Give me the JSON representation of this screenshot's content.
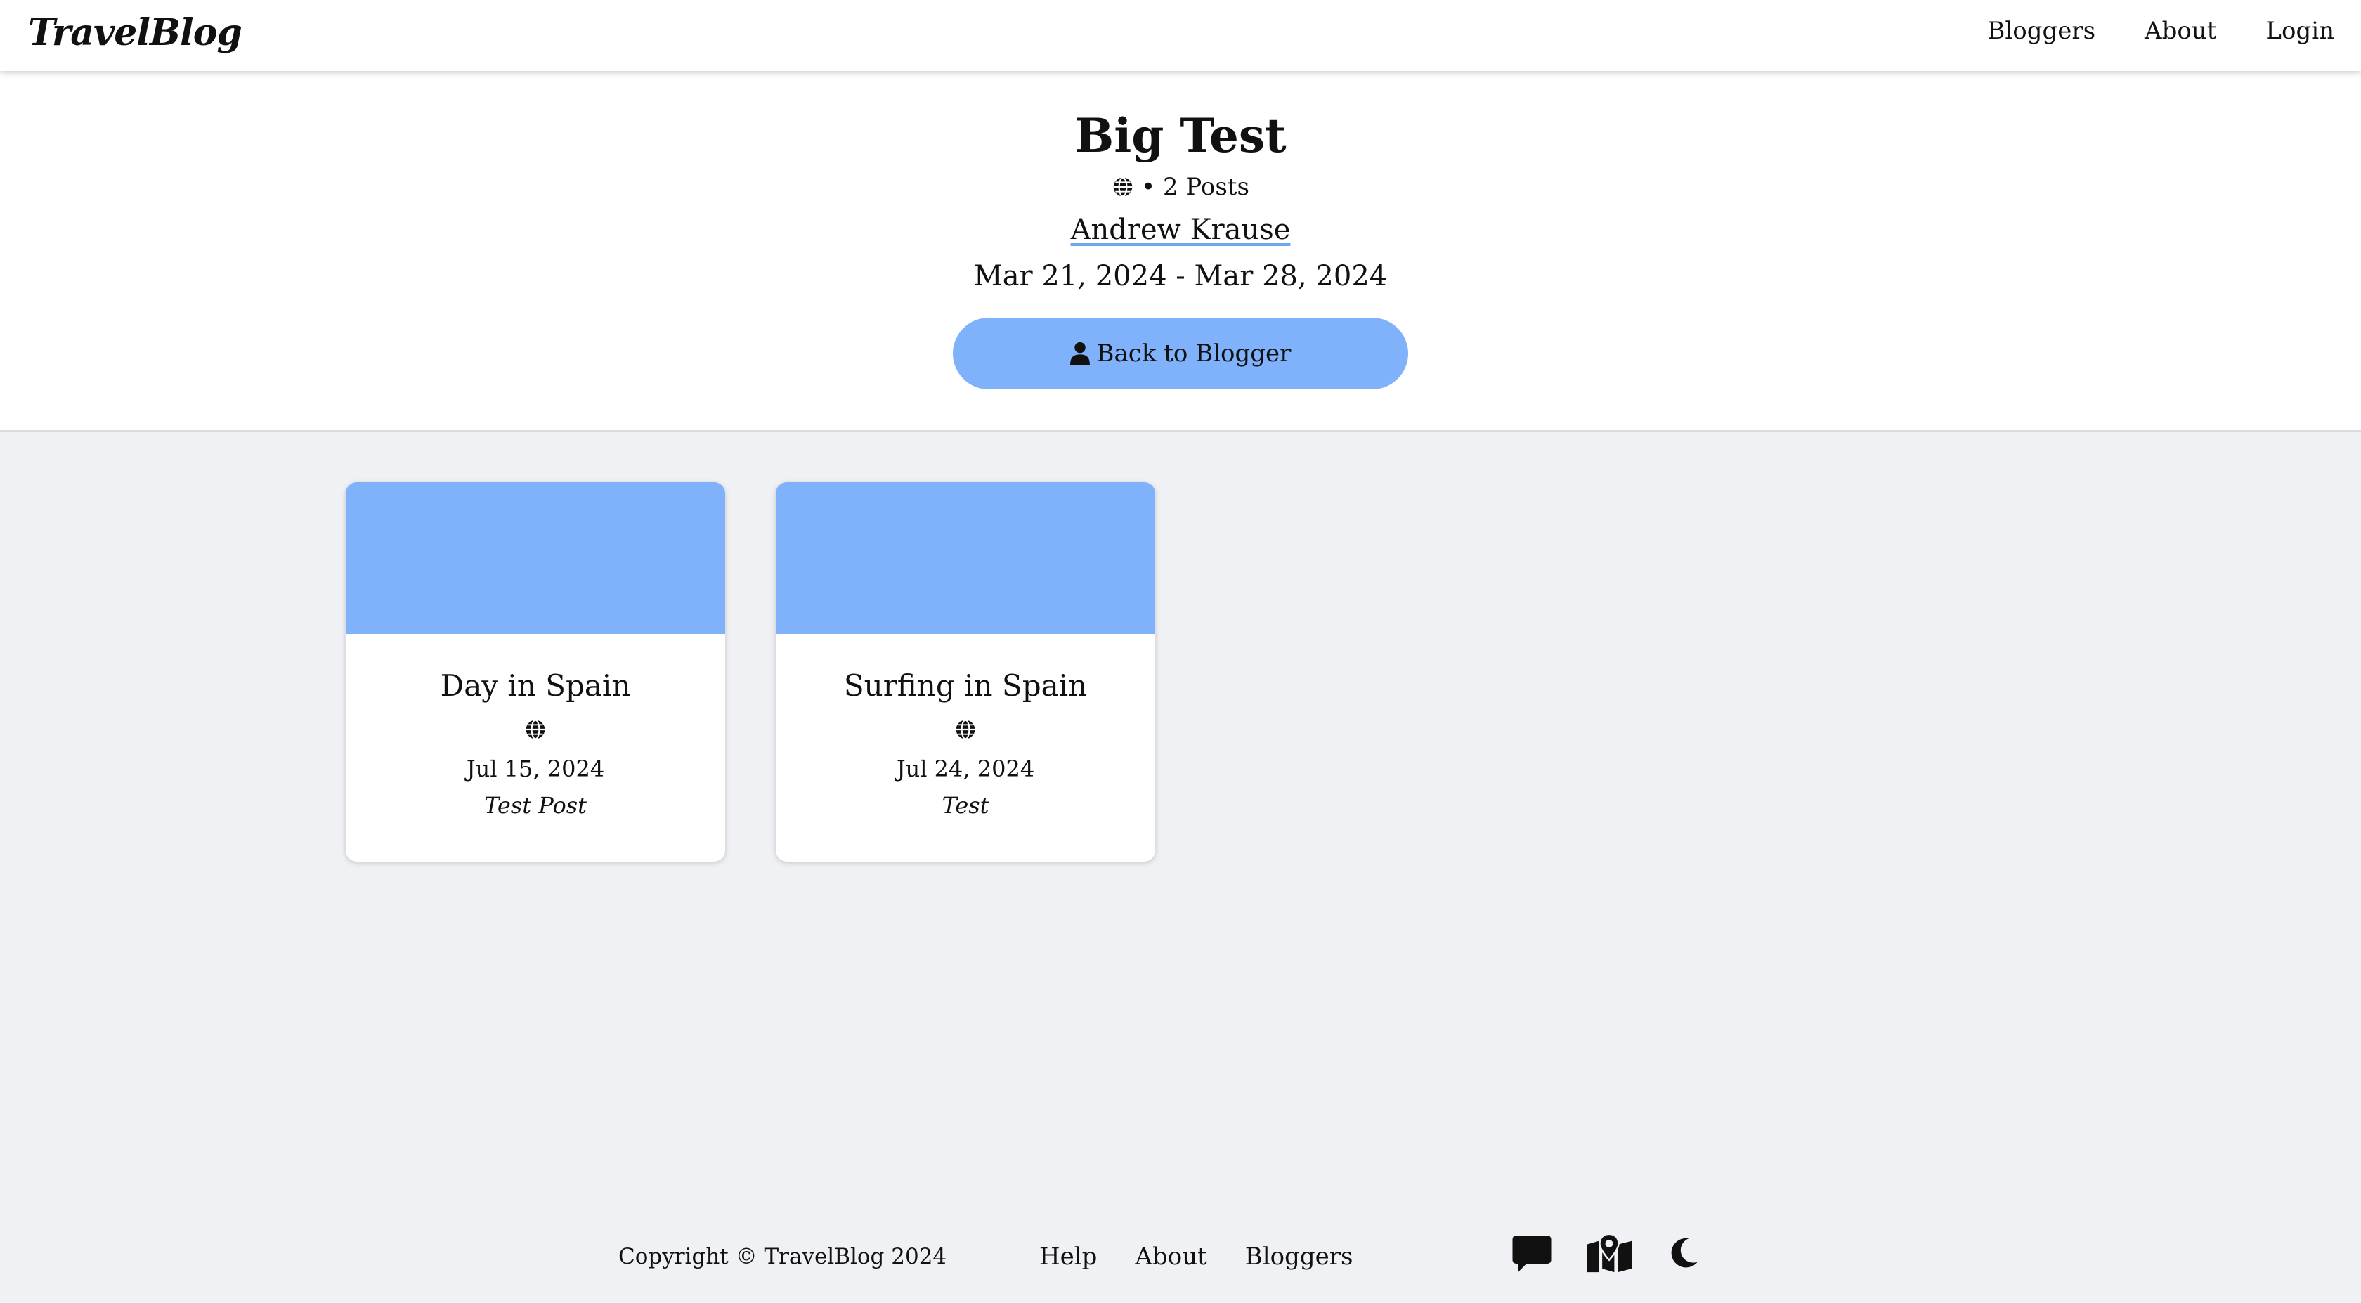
{
  "navbar": {
    "brand": "TravelBlog",
    "links": [
      "Bloggers",
      "About",
      "Login"
    ]
  },
  "trip": {
    "title": "Big Test",
    "meta": "• 2 Posts",
    "author": "Andrew Krause",
    "dates": "Mar 21, 2024 - Mar 28, 2024",
    "back_button": "Back to Blogger"
  },
  "posts": [
    {
      "title": "Day in Spain",
      "date": "Jul 15, 2024",
      "subtitle": "Test Post"
    },
    {
      "title": "Surfing in Spain",
      "date": "Jul 24, 2024",
      "subtitle": "Test"
    }
  ],
  "footer": {
    "copyright": "Copyright © TravelBlog 2024",
    "links": [
      "Help",
      "About",
      "Bloggers"
    ],
    "icons": [
      "chat-icon",
      "map-icon",
      "moon-icon"
    ]
  },
  "colors": {
    "accent": "#7fb2fb",
    "background": "#f0f1f5",
    "surface": "#ffffff"
  }
}
